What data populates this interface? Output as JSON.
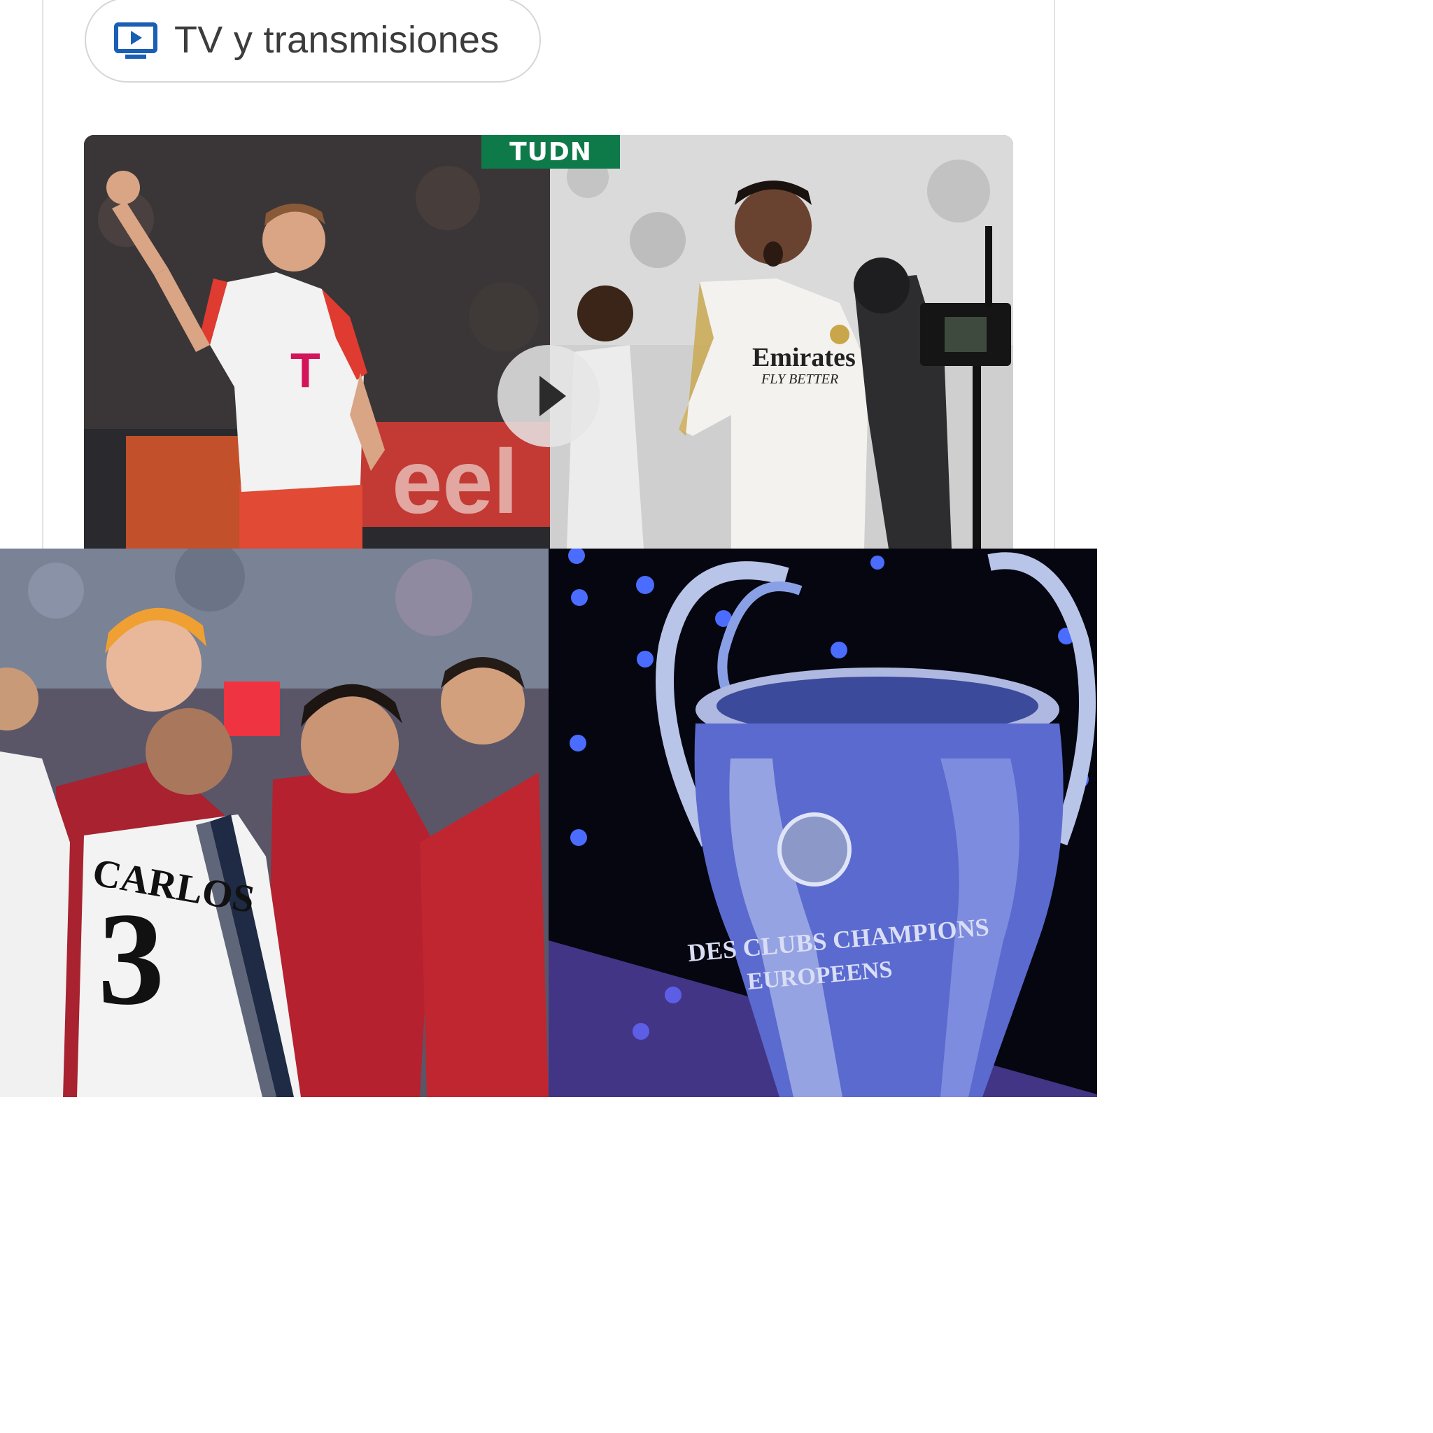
{
  "chip": {
    "label": "TV y transmisiones",
    "icon": "tv-play-icon",
    "accent": "#1a5fb4"
  },
  "video": {
    "watermark": "TUDN",
    "play_icon": "play-icon"
  },
  "photos": {
    "kane_jersey": "T",
    "bellingham_sponsor": "Emirates",
    "bellingham_tagline": "FLY BETTER",
    "carlos_name": "CARLOS",
    "carlos_number": "3",
    "trophy_line1": "DES CLUBS CHAMPIONS",
    "trophy_line2": "EUROPEENS"
  }
}
